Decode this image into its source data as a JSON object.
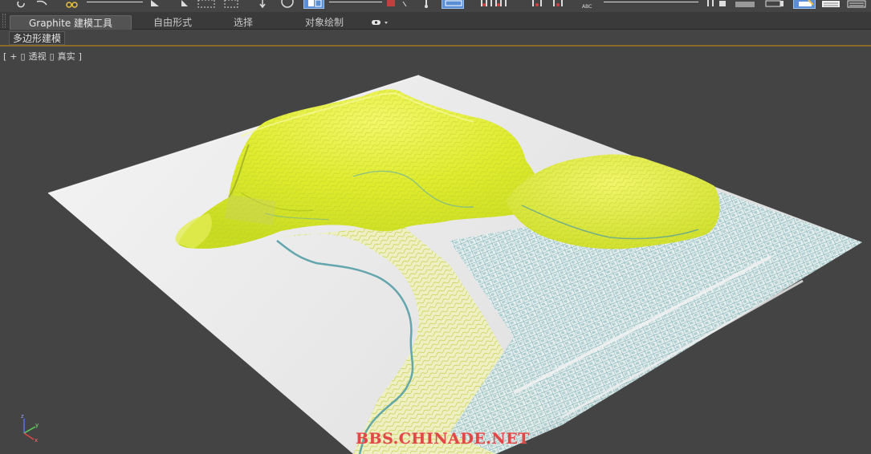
{
  "ribbon": {
    "tabs": [
      {
        "label": "Graphite 建模工具",
        "active": true
      },
      {
        "label": "自由形式",
        "active": false
      },
      {
        "label": "选择",
        "active": false
      },
      {
        "label": "对象绘制",
        "active": false
      }
    ],
    "options_icon": "eye-dropdown-icon"
  },
  "panel": {
    "label": "多边形建模"
  },
  "viewport": {
    "bracket_open": "[",
    "plus": "+",
    "view_name": "透视",
    "shading": "真实",
    "bracket_close": "]",
    "axis": {
      "z": "z",
      "y": "y",
      "x": "x"
    }
  },
  "watermark": "BBS.CHINADE.NET",
  "colors": {
    "background": "#444444",
    "terrain_yellow": "#e6f03a",
    "terrain_cyan": "#5aa8b0",
    "base_plane": "#ececec",
    "accent_blue": "#5a8fd6",
    "watermark": "#e04848"
  }
}
